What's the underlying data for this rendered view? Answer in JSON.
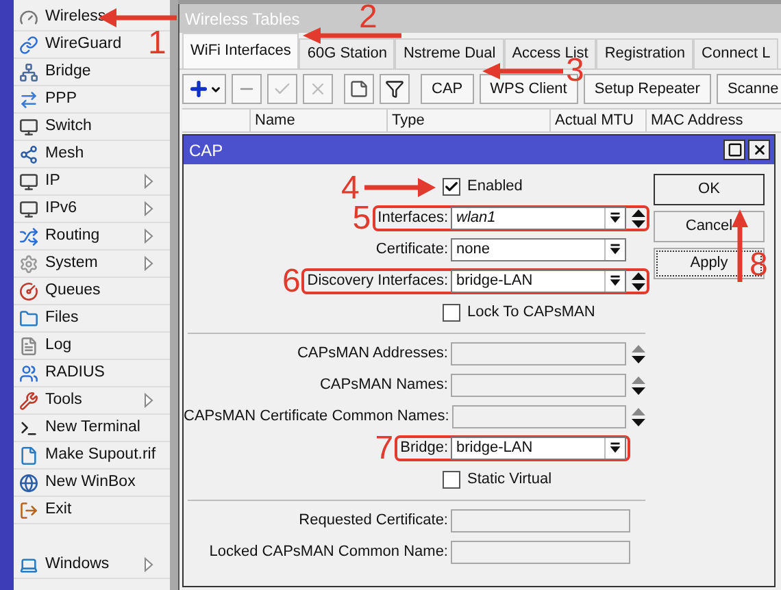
{
  "sidebar": {
    "items": [
      {
        "label": "Wireless",
        "submenu": false
      },
      {
        "label": "WireGuard",
        "submenu": false
      },
      {
        "label": "Bridge",
        "submenu": false
      },
      {
        "label": "PPP",
        "submenu": false
      },
      {
        "label": "Switch",
        "submenu": false
      },
      {
        "label": "Mesh",
        "submenu": false
      },
      {
        "label": "IP",
        "submenu": true
      },
      {
        "label": "IPv6",
        "submenu": true
      },
      {
        "label": "Routing",
        "submenu": true
      },
      {
        "label": "System",
        "submenu": true
      },
      {
        "label": "Queues",
        "submenu": false
      },
      {
        "label": "Files",
        "submenu": false
      },
      {
        "label": "Log",
        "submenu": false
      },
      {
        "label": "RADIUS",
        "submenu": false
      },
      {
        "label": "Tools",
        "submenu": true
      },
      {
        "label": "New Terminal",
        "submenu": false
      },
      {
        "label": "Make Supout.rif",
        "submenu": false
      },
      {
        "label": "New WinBox",
        "submenu": false
      },
      {
        "label": "Exit",
        "submenu": false
      }
    ],
    "footer_item": {
      "label": "Windows",
      "submenu": true
    }
  },
  "window": {
    "title": "Wireless Tables",
    "tabs": [
      {
        "label": "WiFi Interfaces",
        "selected": true
      },
      {
        "label": "60G Station",
        "selected": false
      },
      {
        "label": "Nstreme Dual",
        "selected": false
      },
      {
        "label": "Access List",
        "selected": false
      },
      {
        "label": "Registration",
        "selected": false
      },
      {
        "label": "Connect L",
        "selected": false
      }
    ],
    "toolbar_buttons": [
      "CAP",
      "WPS Client",
      "Setup Repeater",
      "Scanne"
    ],
    "table": {
      "columns": [
        "Name",
        "Type",
        "Actual MTU",
        "MAC Address"
      ]
    }
  },
  "dialog": {
    "title": "CAP",
    "rows": [
      {
        "kind": "checkbox",
        "label": "Enabled",
        "checked": true
      },
      {
        "kind": "field",
        "label": "Interfaces:",
        "value": "wlan1",
        "italic": true,
        "dropdown": true,
        "updown": true,
        "disabled": false,
        "annotation": "5"
      },
      {
        "kind": "field",
        "label": "Certificate:",
        "value": "none",
        "dropdown": true,
        "updown": false,
        "disabled": false
      },
      {
        "kind": "field",
        "label": "Discovery Interfaces:",
        "value": "bridge-LAN",
        "dropdown": true,
        "updown": true,
        "disabled": false,
        "annotation": "6"
      },
      {
        "kind": "checkbox",
        "label": "Lock To CAPsMAN",
        "checked": false
      },
      {
        "kind": "separator"
      },
      {
        "kind": "field",
        "label": "CAPsMAN Addresses:",
        "dropdown": false,
        "updown": true,
        "disabled": true
      },
      {
        "kind": "field",
        "label": "CAPsMAN Names:",
        "dropdown": false,
        "updown": true,
        "disabled": true
      },
      {
        "kind": "field",
        "label": "CAPsMAN Certificate Common Names:",
        "dropdown": false,
        "updown": true,
        "disabled": true
      },
      {
        "kind": "field",
        "label": "Bridge:",
        "value": "bridge-LAN",
        "dropdown": true,
        "updown": false,
        "disabled": false,
        "annotation": "7"
      },
      {
        "kind": "checkbox",
        "label": "Static Virtual",
        "checked": false
      },
      {
        "kind": "separator"
      },
      {
        "kind": "status",
        "label": "Requested Certificate:"
      },
      {
        "kind": "status",
        "label": "Locked CAPsMAN Common Name:"
      }
    ],
    "buttons": [
      {
        "label": "OK",
        "focused": false
      },
      {
        "label": "Cancel",
        "focused": false
      },
      {
        "label": "Apply",
        "focused": true
      }
    ]
  },
  "annotations": [
    "1",
    "2",
    "3",
    "4",
    "8"
  ]
}
